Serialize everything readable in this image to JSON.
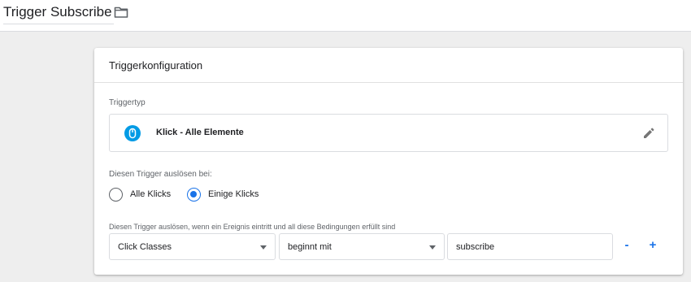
{
  "header": {
    "title": "Trigger Subscribe",
    "folder_icon": "folder-icon"
  },
  "card": {
    "title": "Triggerkonfiguration",
    "trigger_type": {
      "label": "Triggertyp",
      "value": "Klick - Alle Elemente",
      "icon": "mouse-icon",
      "edit_icon": "pencil-icon"
    },
    "fire_on": {
      "label": "Diesen Trigger auslösen bei:",
      "options": [
        {
          "label": "Alle Klicks",
          "selected": false
        },
        {
          "label": "Einige Klicks",
          "selected": true
        }
      ]
    },
    "conditions": {
      "label": "Diesen Trigger auslösen, wenn ein Ereignis eintritt und all diese Bedingungen erfüllt sind",
      "variable": "Click Classes",
      "operator": "beginnt mit",
      "value": "subscribe",
      "remove_label": "-",
      "add_label": "+"
    }
  },
  "colors": {
    "accent": "#1a73e8",
    "mouse_icon": "#039be5"
  }
}
